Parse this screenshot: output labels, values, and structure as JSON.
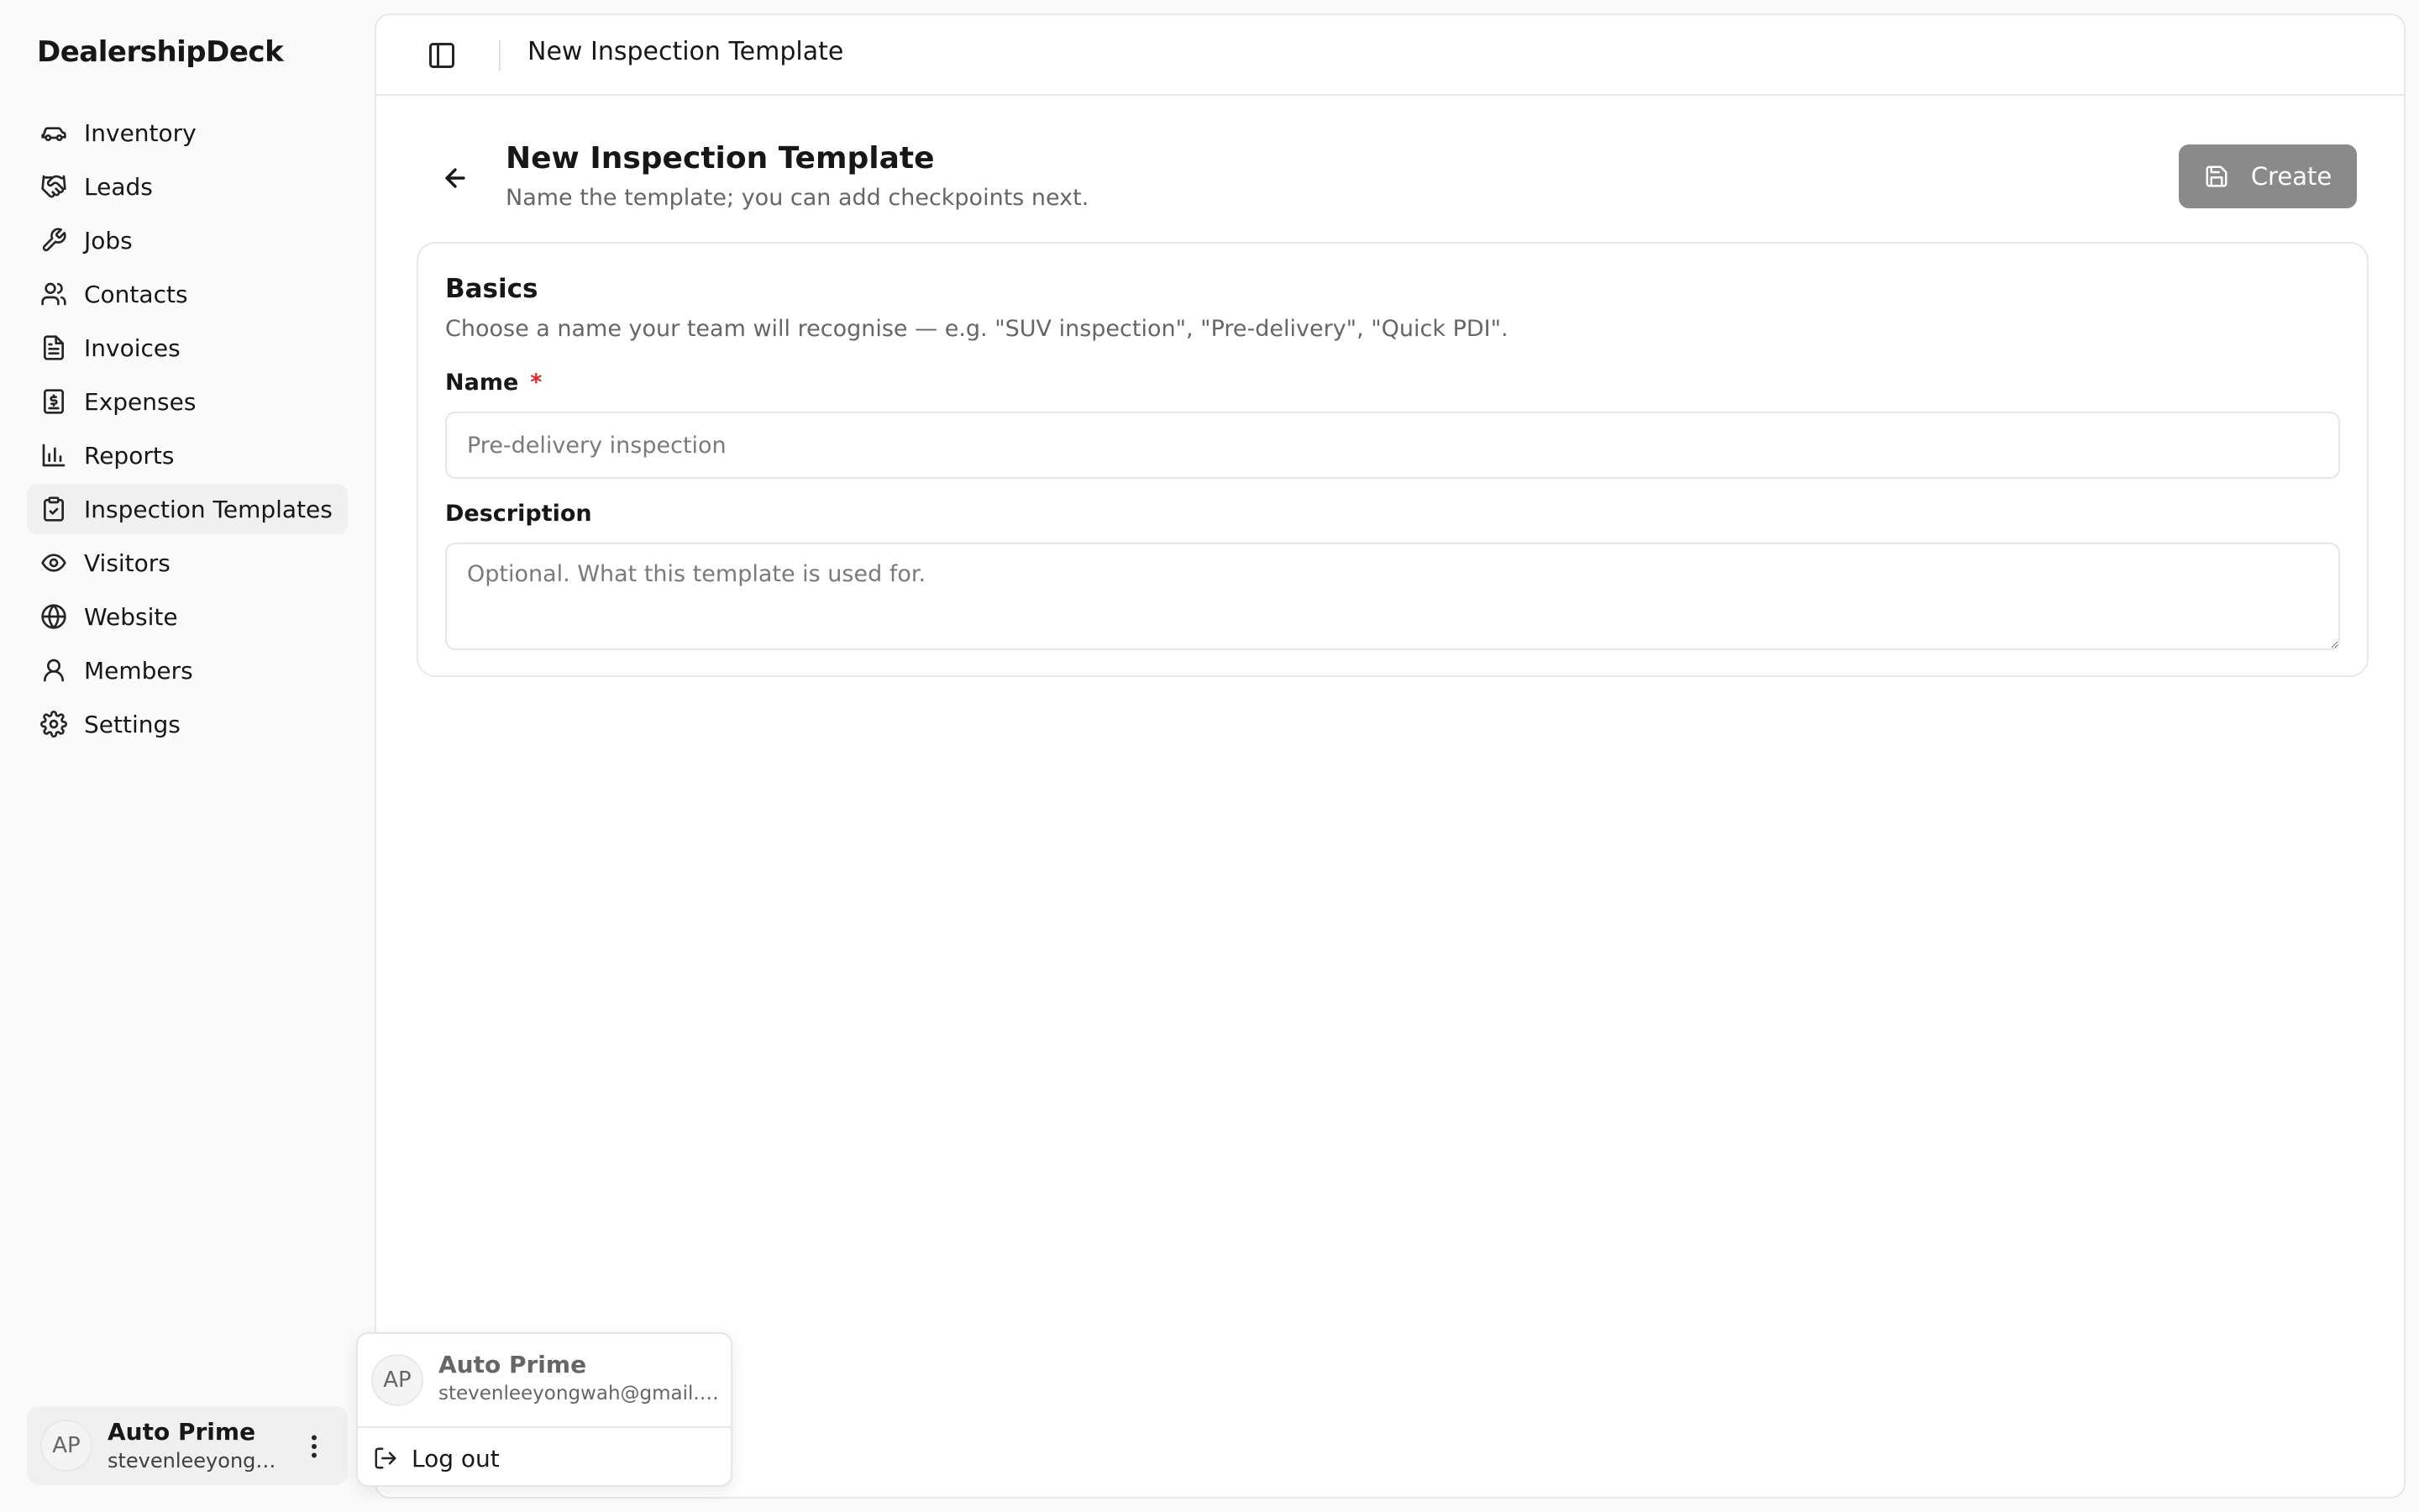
{
  "brand": "DealershipDeck",
  "sidebar": {
    "items": [
      {
        "label": "Inventory",
        "icon": "car-icon"
      },
      {
        "label": "Leads",
        "icon": "handshake-icon"
      },
      {
        "label": "Jobs",
        "icon": "wrench-icon"
      },
      {
        "label": "Contacts",
        "icon": "users-icon"
      },
      {
        "label": "Invoices",
        "icon": "file-text-icon"
      },
      {
        "label": "Expenses",
        "icon": "receipt-icon"
      },
      {
        "label": "Reports",
        "icon": "bar-chart-icon"
      },
      {
        "label": "Inspection Templates",
        "icon": "clipboard-check-icon",
        "active": true
      },
      {
        "label": "Visitors",
        "icon": "eye-icon"
      },
      {
        "label": "Website",
        "icon": "globe-icon"
      },
      {
        "label": "Members",
        "icon": "user-icon"
      },
      {
        "label": "Settings",
        "icon": "gear-icon"
      }
    ]
  },
  "user": {
    "initials": "AP",
    "name": "Auto Prime",
    "email_truncated": "stevenleeyongwa...",
    "email": "stevenleeyongwah@gmail.c..."
  },
  "topbar": {
    "title": "New Inspection Template"
  },
  "page": {
    "title": "New Inspection Template",
    "subtitle": "Name the template; you can add checkpoints next.",
    "create_label": "Create"
  },
  "card": {
    "title": "Basics",
    "description": "Choose a name your team will recognise — e.g. \"SUV inspection\", \"Pre-delivery\", \"Quick PDI\".",
    "name_label": "Name",
    "required_mark": "*",
    "name_placeholder": "Pre-delivery inspection",
    "name_value": "",
    "description_label": "Description",
    "description_placeholder": "Optional. What this template is used for.",
    "description_value": ""
  },
  "menu": {
    "logout_label": "Log out"
  },
  "colors": {
    "primary_disabled": "#8a8a8a",
    "required": "#dc2626",
    "active_nav": "#f0f0f0"
  }
}
